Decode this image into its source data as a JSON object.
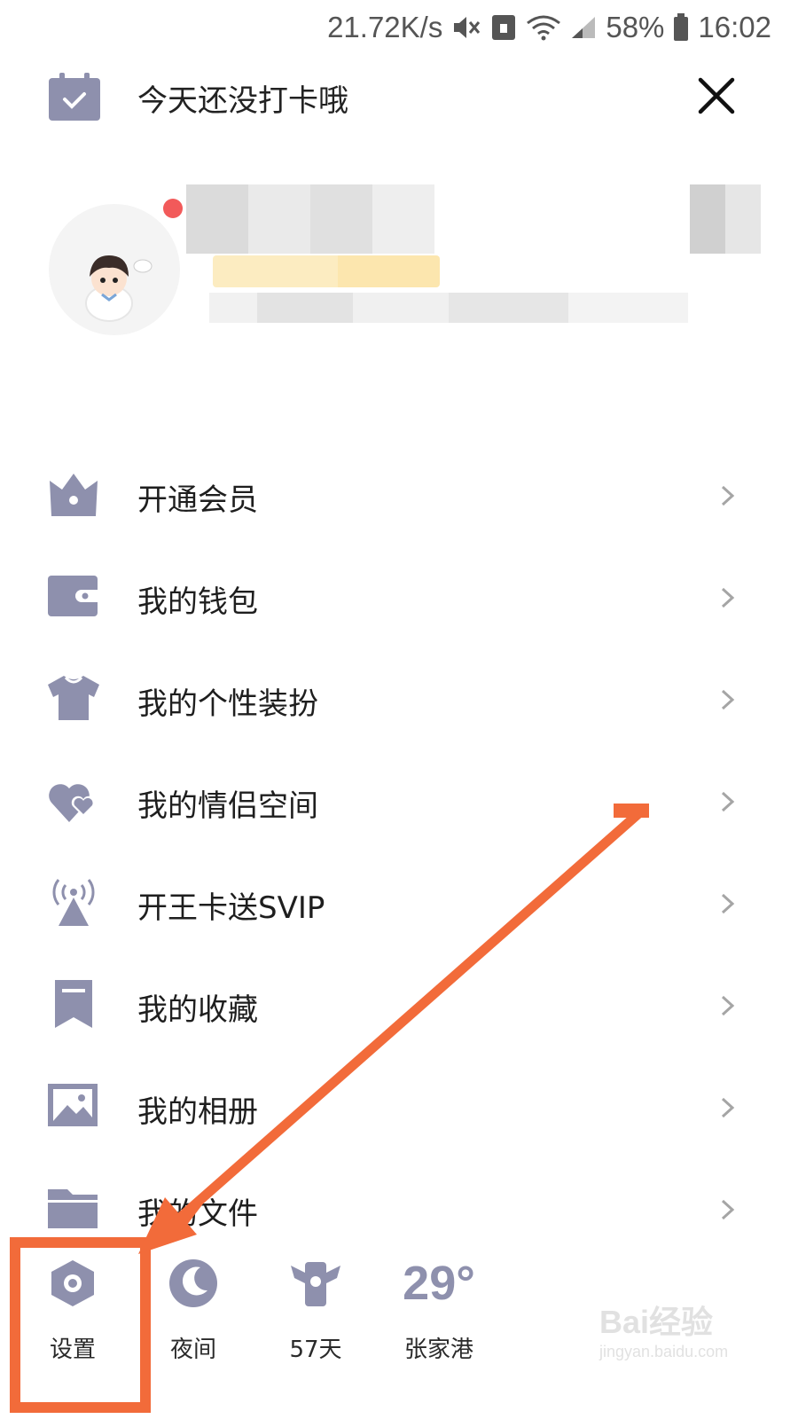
{
  "status_bar": {
    "speed": "21.72K/s",
    "battery": "58%",
    "time": "16:02"
  },
  "top": {
    "checkin_text": "今天还没打卡哦"
  },
  "menu": [
    {
      "label": "开通会员",
      "icon": "vip-crown-icon"
    },
    {
      "label": "我的钱包",
      "icon": "wallet-icon"
    },
    {
      "label": "我的个性装扮",
      "icon": "tshirt-icon"
    },
    {
      "label": "我的情侣空间",
      "icon": "hearts-icon"
    },
    {
      "label": "开王卡送SVIP",
      "icon": "signal-tower-icon"
    },
    {
      "label": "我的收藏",
      "icon": "bookmark-icon"
    },
    {
      "label": "我的相册",
      "icon": "photo-icon"
    },
    {
      "label": "我的文件",
      "icon": "folder-icon"
    }
  ],
  "bottom": {
    "settings": "设置",
    "night": "夜间",
    "days": "57天",
    "temperature": "29°",
    "city": "张家港"
  },
  "watermark": {
    "brand": "Bai经验",
    "url": "jingyan.baidu.com"
  },
  "colors": {
    "icon": "#8e90ad",
    "highlight": "#f26b3a",
    "badge": "#f25a5a"
  }
}
